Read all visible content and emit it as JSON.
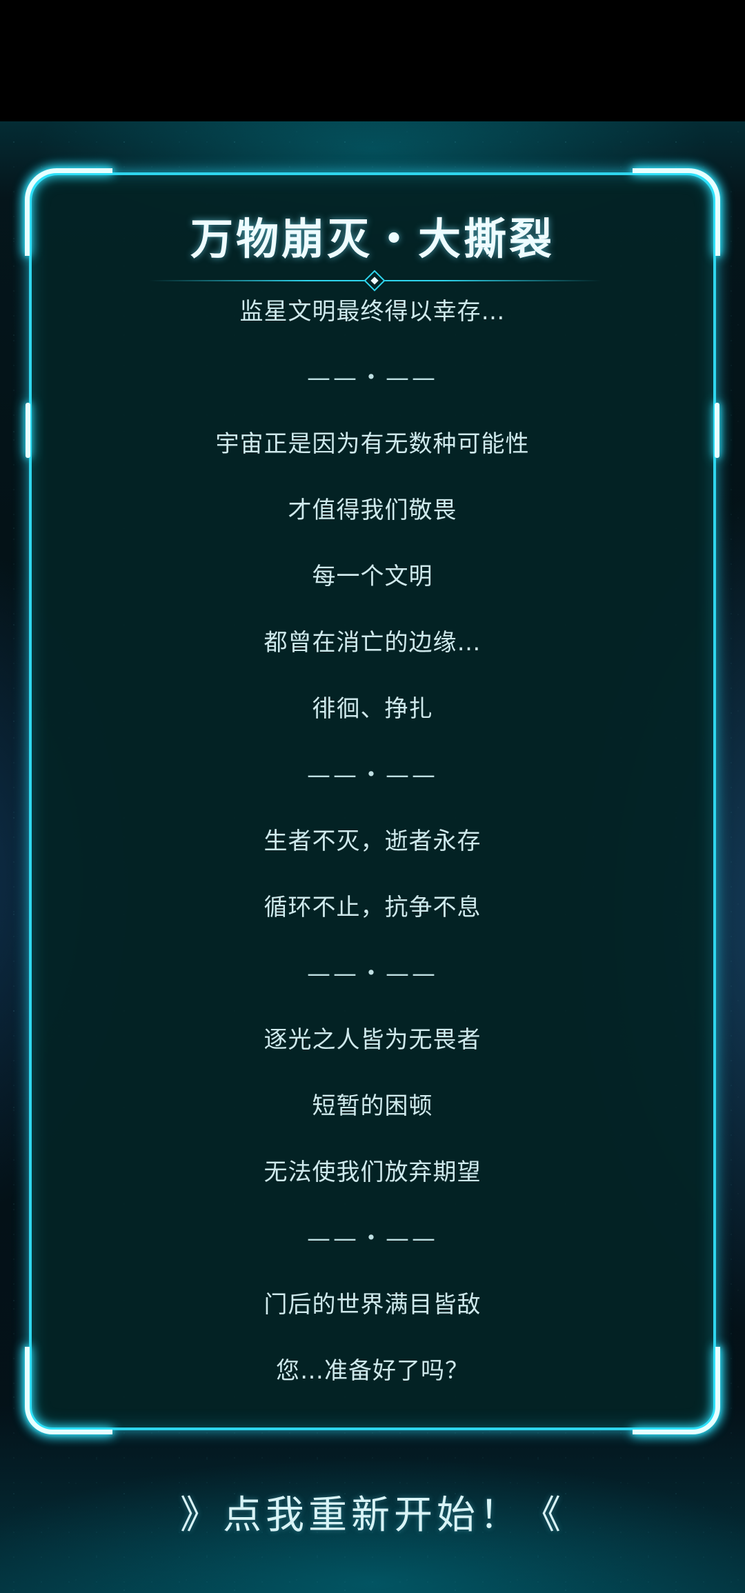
{
  "panel": {
    "title": "万物崩灭・大撕裂",
    "lines": [
      "监星文明最终得以幸存…",
      "——・——",
      "宇宙正是因为有无数种可能性",
      "才值得我们敬畏",
      "每一个文明",
      "都曾在消亡的边缘…",
      "徘徊、挣扎",
      "——・——",
      "生者不灭，逝者永存",
      "循环不止，抗争不息",
      "——・——",
      "逐光之人皆为无畏者",
      "短暂的困顿",
      "无法使我们放弃期望",
      "——・——",
      "门后的世界满目皆敌",
      "您…准备好了吗？"
    ]
  },
  "restart_button": {
    "label": "》点我重新开始！《"
  },
  "colors": {
    "accent": "#2fd6ee",
    "panel_bg": "#032326",
    "text": "#cfe9ec"
  },
  "icons": {
    "title_divider": "diamond-ornament-icon"
  }
}
